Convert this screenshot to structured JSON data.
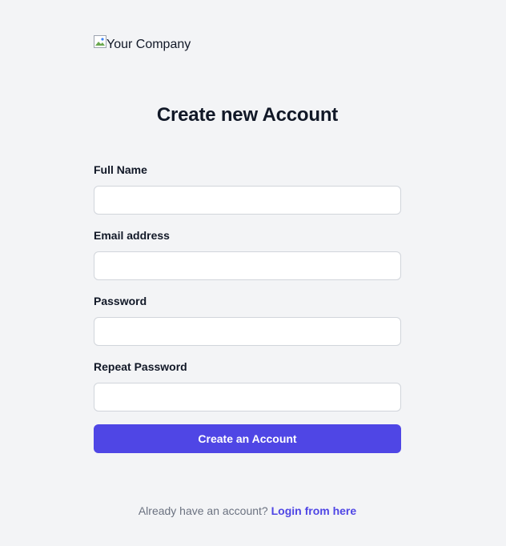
{
  "logo": {
    "alt_text": "Your Company",
    "icon": "broken-image-icon"
  },
  "heading": "Create new Account",
  "form": {
    "full_name": {
      "label": "Full Name",
      "value": "",
      "placeholder": ""
    },
    "email": {
      "label": "Email address",
      "value": "",
      "placeholder": ""
    },
    "password": {
      "label": "Password",
      "value": "",
      "placeholder": ""
    },
    "repeat_password": {
      "label": "Repeat Password",
      "value": "",
      "placeholder": ""
    },
    "submit_label": "Create an Account"
  },
  "footer": {
    "prompt": "Already have an account?",
    "link_label": "Login from here"
  },
  "colors": {
    "background": "#f3f4f6",
    "accent": "#4f46e5",
    "input_border": "#d1d5db",
    "text": "#111827",
    "muted": "#6b7280"
  }
}
